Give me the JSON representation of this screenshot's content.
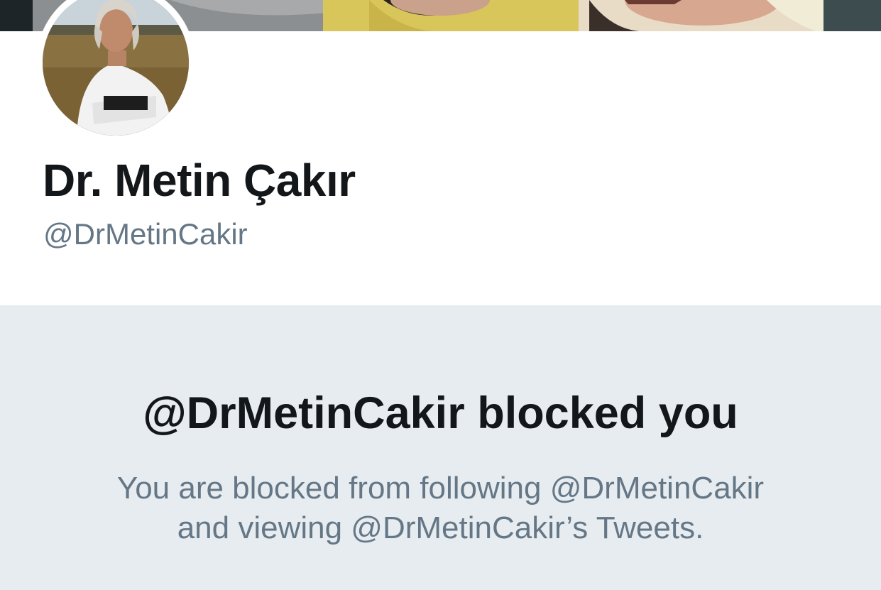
{
  "profile": {
    "display_name": "Dr. Metin Çakır",
    "handle": "@DrMetinCakir",
    "avatar_icon": "profile-photo",
    "banner_icon": "header-photo"
  },
  "blocked_notice": {
    "title": "@DrMetinCakir blocked you",
    "message_line1": "You are blocked from following @DrMetinCakir",
    "message_line2": "and viewing @DrMetinCakir’s Tweets."
  },
  "colors": {
    "name_text": "#14171a",
    "secondary_text": "#657786",
    "panel_background": "#e6ecf0"
  }
}
